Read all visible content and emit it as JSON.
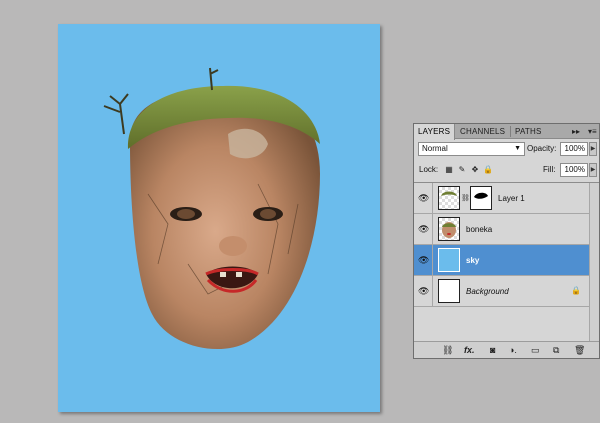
{
  "panel": {
    "tabs": [
      {
        "label": "LAYERS",
        "active": true
      },
      {
        "label": "CHANNELS",
        "active": false
      },
      {
        "label": "PATHS",
        "active": false
      }
    ],
    "menu_glyphs": [
      "▸▸",
      "▾≡"
    ],
    "blend_mode": "Normal",
    "opacity_label": "Opacity:",
    "opacity_value": "100%",
    "lock_label": "Lock:",
    "fill_label": "Fill:",
    "fill_value": "100%",
    "layers": [
      {
        "name": "Layer 1",
        "visible": true,
        "selected": false,
        "has_mask": true,
        "locked": false,
        "italic": false
      },
      {
        "name": "boneka",
        "visible": true,
        "selected": false,
        "has_mask": false,
        "locked": false,
        "italic": false
      },
      {
        "name": "sky",
        "visible": true,
        "selected": true,
        "has_mask": false,
        "locked": false,
        "italic": false
      },
      {
        "name": "Background",
        "visible": true,
        "selected": false,
        "has_mask": false,
        "locked": true,
        "italic": true
      }
    ],
    "footer_icons": [
      "link-icon",
      "fx-icon",
      "mask-icon",
      "adjustment-icon",
      "group-icon",
      "new-layer-icon",
      "trash-icon"
    ]
  },
  "colors": {
    "canvas_sky": "#6bbcec",
    "selection": "#4f8fd0",
    "panel_bg": "#d6d6d6",
    "workspace": "#b9b8b8"
  }
}
